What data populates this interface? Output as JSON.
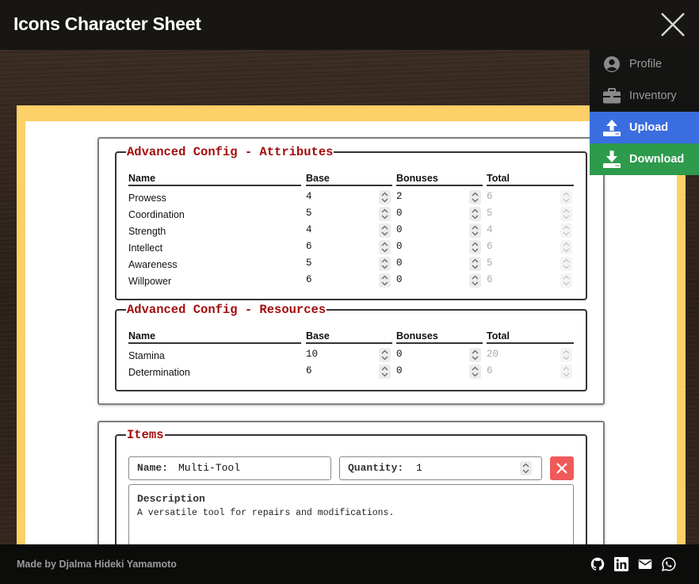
{
  "header": {
    "title": "Icons Character Sheet"
  },
  "menu": {
    "profile": "Profile",
    "inventory": "Inventory",
    "upload": "Upload",
    "download": "Download"
  },
  "attributes": {
    "legend": "Advanced Config - Attributes",
    "headers": {
      "name": "Name",
      "base": "Base",
      "bonuses": "Bonuses",
      "total": "Total"
    },
    "rows": [
      {
        "name": "Prowess",
        "base": "4",
        "bonuses": "2",
        "total": "6"
      },
      {
        "name": "Coordination",
        "base": "5",
        "bonuses": "0",
        "total": "5"
      },
      {
        "name": "Strength",
        "base": "4",
        "bonuses": "0",
        "total": "4"
      },
      {
        "name": "Intellect",
        "base": "6",
        "bonuses": "0",
        "total": "6"
      },
      {
        "name": "Awareness",
        "base": "5",
        "bonuses": "0",
        "total": "5"
      },
      {
        "name": "Willpower",
        "base": "6",
        "bonuses": "0",
        "total": "6"
      }
    ]
  },
  "resources": {
    "legend": "Advanced Config - Resources",
    "headers": {
      "name": "Name",
      "base": "Base",
      "bonuses": "Bonuses",
      "total": "Total"
    },
    "rows": [
      {
        "name": "Stamina",
        "base": "10",
        "bonuses": "0",
        "total": "20"
      },
      {
        "name": "Determination",
        "base": "6",
        "bonuses": "0",
        "total": "6"
      }
    ]
  },
  "items": {
    "legend": "Items",
    "name_label": "Name:",
    "name_value": "Multi-Tool",
    "quantity_label": "Quantity:",
    "quantity_value": "1",
    "description_label": "Description",
    "description_text": "A versatile tool for repairs and modifications."
  },
  "footer": {
    "credit": "Made by Djalma Hideki Yamamoto"
  },
  "colors": {
    "legend": "#a30c0c",
    "upload": "#3a6de0",
    "download": "#2e9a4c",
    "delete": "#f05a5a",
    "sheet_frame": "#fdd068"
  }
}
